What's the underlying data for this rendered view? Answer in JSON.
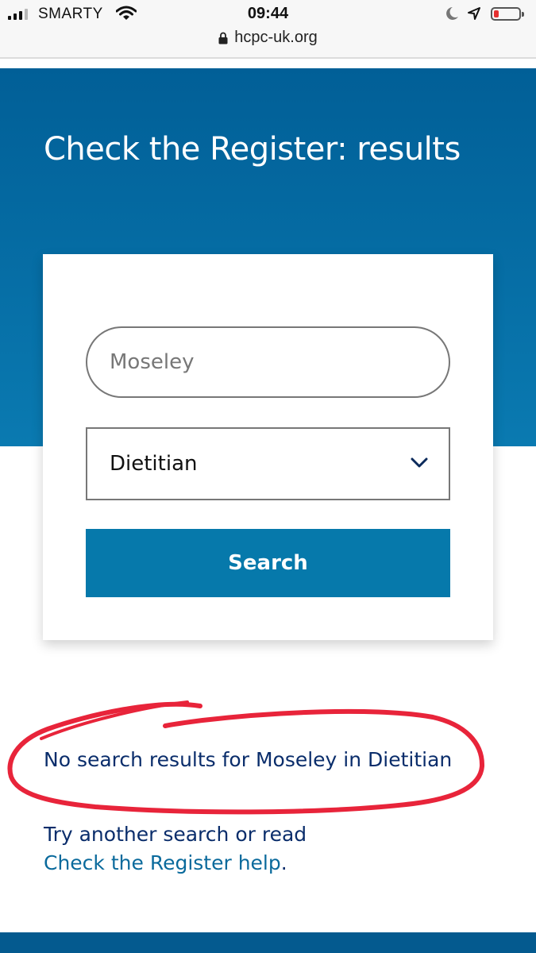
{
  "status_bar": {
    "carrier": "SMARTY",
    "time": "09:44",
    "url": "hcpc-uk.org",
    "battery_level": 0.12,
    "icons": [
      "signal-icon",
      "wifi-icon",
      "moon-icon",
      "location-arrow-icon",
      "battery-icon",
      "lock-icon"
    ]
  },
  "page": {
    "title": "Check the Register: results"
  },
  "search_form": {
    "name_value": "",
    "name_placeholder": "Moseley",
    "profession_selected": "Dietitian",
    "button_label": "Search"
  },
  "results": {
    "message": "No search results for Moseley in Dietitian",
    "help_prefix": "Try another search or read",
    "help_link": "Check the Register help",
    "help_suffix": "."
  },
  "colors": {
    "hero_top": "#015f97",
    "hero_bottom": "#0a7ab1",
    "button": "#0679ab",
    "text_dark": "#0a2d6b",
    "link": "#0a6a9c",
    "annotation": "#e8243a"
  }
}
